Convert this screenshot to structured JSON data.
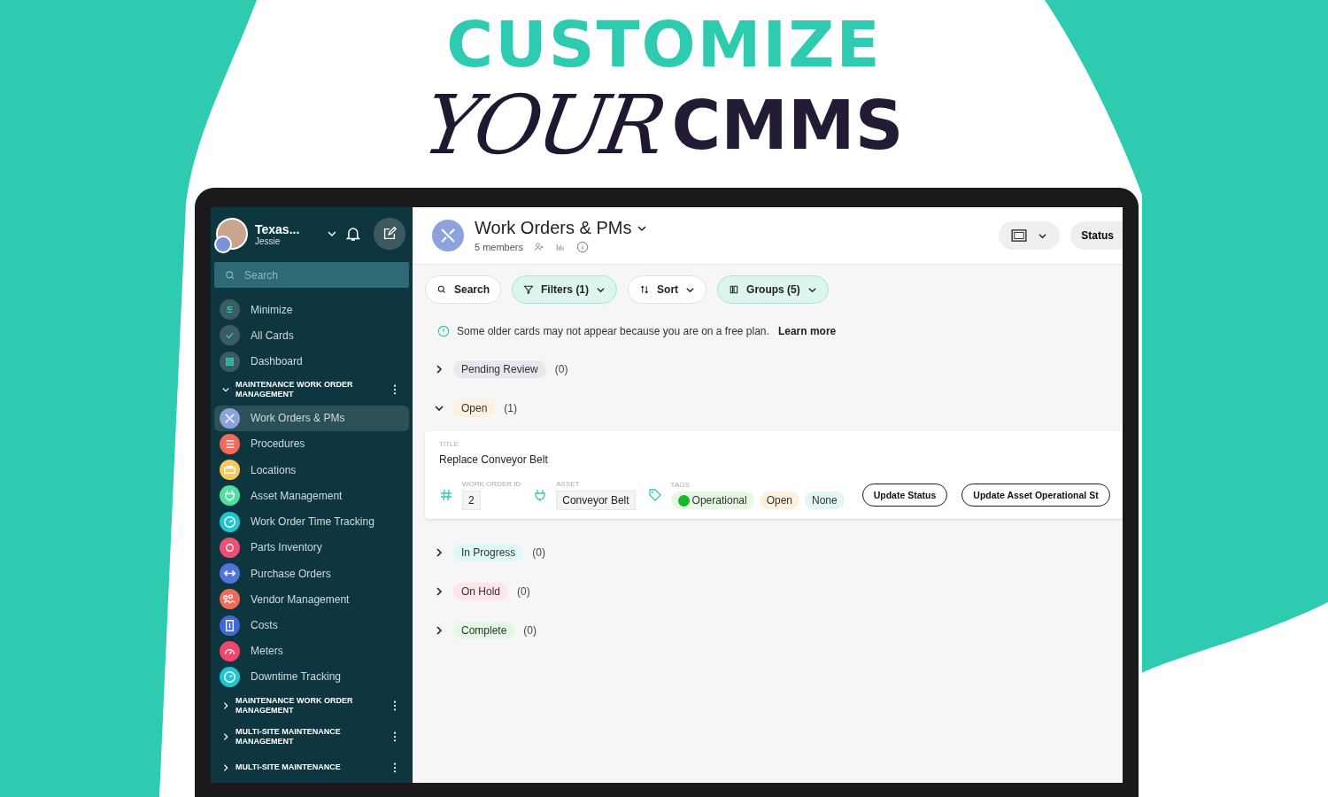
{
  "headline": {
    "line_1": "CUSTOMIZE",
    "script_word": "YOUR",
    "bold_word": "CMMS"
  },
  "sidebar": {
    "workspace": "Texas...",
    "user": "Jessie",
    "search": {
      "placeholder": "Search"
    },
    "nav_items": [
      {
        "label": "Minimize"
      },
      {
        "label": "All Cards"
      },
      {
        "label": "Dashboard"
      }
    ],
    "groups": [
      {
        "title": "MAINTENANCE WORK ORDER MANAGEMENT",
        "expanded": true,
        "items": [
          {
            "label": "Work Orders & PMs",
            "color": "#8da2dd",
            "selected": true
          },
          {
            "label": "Procedures",
            "color": "#f4695a",
            "selected": false
          },
          {
            "label": "Locations",
            "color": "#f9c85c",
            "selected": false
          },
          {
            "label": "Asset Management",
            "color": "#4fe0a0",
            "selected": false
          },
          {
            "label": "Work Order Time Tracking",
            "color": "#1ec6d2",
            "selected": false
          },
          {
            "label": "Parts Inventory",
            "color": "#f04e72",
            "selected": false
          },
          {
            "label": "Purchase Orders",
            "color": "#4f75db",
            "selected": false
          },
          {
            "label": "Vendor Management",
            "color": "#f56a55",
            "selected": false
          },
          {
            "label": "Costs",
            "color": "#3f67d6",
            "selected": false
          },
          {
            "label": "Meters",
            "color": "#f0456c",
            "selected": false
          },
          {
            "label": "Downtime Tracking",
            "color": "#1ec6d2",
            "selected": false
          }
        ]
      },
      {
        "title": "MAINTENANCE WORK ORDER MANAGEMENT",
        "expanded": false
      },
      {
        "title": "MULTI-SITE MAINTENANCE MANAGEMENT",
        "expanded": false
      },
      {
        "title": "MULTI-SITE MAINTENANCE",
        "expanded": false
      }
    ]
  },
  "header": {
    "title": "Work Orders & PMs",
    "members": "5 members",
    "status_button": "Status"
  },
  "toolbar": [
    {
      "label": "Search",
      "active": false
    },
    {
      "label": "Filters (1)",
      "active": true
    },
    {
      "label": "Sort",
      "active": false
    },
    {
      "label": "Groups (5)",
      "active": true
    }
  ],
  "notice": {
    "text": "Some older cards may not appear because you are on a free plan.",
    "link": "Learn more"
  },
  "groups": [
    {
      "label": "Pending Review",
      "count": "(0)",
      "color": "#e9e6f0",
      "expanded": false
    },
    {
      "label": "Open",
      "count": "(1)",
      "color": "#fdf1dd",
      "expanded": true,
      "cards": [
        {
          "title_label": "TITLE",
          "title": "Replace Conveyor Belt",
          "id_label": "WORK ORDER ID",
          "id": "2",
          "asset_label": "ASSET",
          "asset": "Conveyor Belt",
          "tags_label": "TAGS",
          "tags": [
            {
              "label": "Operational",
              "color": "#e6f8e4",
              "dot": true
            },
            {
              "label": "Open",
              "color": "#fdf1dd",
              "dot": false
            },
            {
              "label": "None",
              "color": "#e2f6f4",
              "dot": false
            }
          ],
          "buttons": [
            "Update Status",
            "Update Asset Operational St"
          ]
        }
      ]
    },
    {
      "label": "In Progress",
      "count": "(0)",
      "color": "#e0f7f7",
      "expanded": false
    },
    {
      "label": "On Hold",
      "count": "(0)",
      "color": "#fde5ea",
      "expanded": false
    },
    {
      "label": "Complete",
      "count": "(0)",
      "color": "#e3f8e3",
      "expanded": false
    }
  ]
}
